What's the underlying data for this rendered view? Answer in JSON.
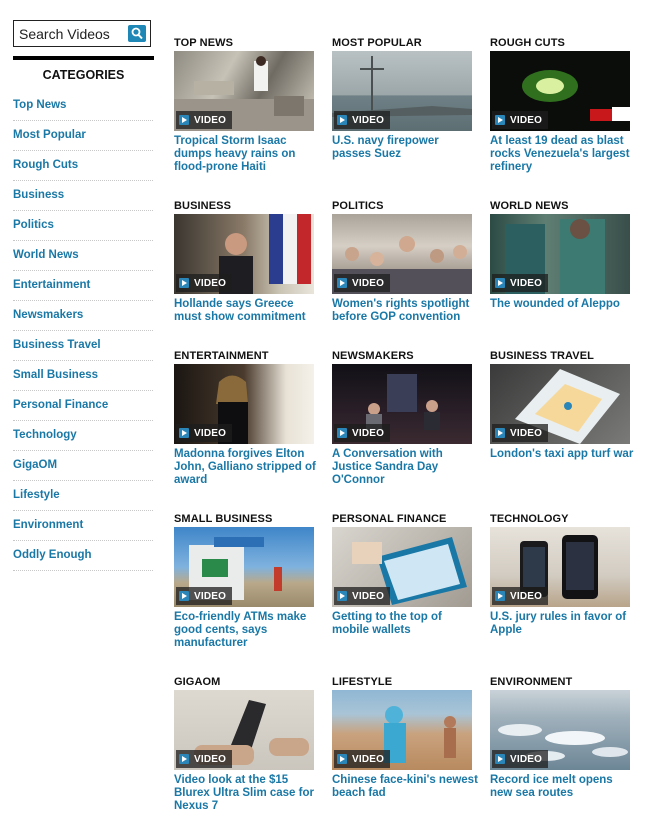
{
  "search": {
    "placeholder": "Search Videos"
  },
  "sidebar": {
    "title": "CATEGORIES",
    "items": [
      {
        "label": "Top News"
      },
      {
        "label": "Most Popular"
      },
      {
        "label": "Rough Cuts"
      },
      {
        "label": "Business"
      },
      {
        "label": "Politics"
      },
      {
        "label": "World News"
      },
      {
        "label": "Entertainment"
      },
      {
        "label": "Newsmakers"
      },
      {
        "label": "Business Travel"
      },
      {
        "label": "Small Business"
      },
      {
        "label": "Personal Finance"
      },
      {
        "label": "Technology"
      },
      {
        "label": "GigaOM"
      },
      {
        "label": "Lifestyle"
      },
      {
        "label": "Environment"
      },
      {
        "label": "Oddly Enough"
      }
    ]
  },
  "video_badge": "VIDEO",
  "cards": [
    {
      "label": "TOP NEWS",
      "headline": "Tropical Storm Isaac dumps heavy rains on flood-prone Haiti"
    },
    {
      "label": "MOST POPULAR",
      "headline": "U.S. navy firepower passes Suez"
    },
    {
      "label": "ROUGH CUTS",
      "headline": "At least 19 dead as blast rocks Venezuela's largest refinery"
    },
    {
      "label": "BUSINESS",
      "headline": "Hollande says Greece must show commitment"
    },
    {
      "label": "POLITICS",
      "headline": "Women's rights spotlight before GOP convention"
    },
    {
      "label": "WORLD NEWS",
      "headline": "The wounded of Aleppo"
    },
    {
      "label": "ENTERTAINMENT",
      "headline": "Madonna forgives Elton John, Galliano stripped of award"
    },
    {
      "label": "NEWSMAKERS",
      "headline": "A Conversation with Justice Sandra Day O'Connor"
    },
    {
      "label": "BUSINESS TRAVEL",
      "headline": "London's taxi app turf war"
    },
    {
      "label": "SMALL BUSINESS",
      "headline": "Eco-friendly ATMs make good cents, says manufacturer"
    },
    {
      "label": "PERSONAL FINANCE",
      "headline": "Getting to the top of mobile wallets"
    },
    {
      "label": "TECHNOLOGY",
      "headline": "U.S. jury rules in favor of Apple"
    },
    {
      "label": "GIGAOM",
      "headline": "Video look at the $15 Blurex Ultra Slim case for Nexus 7"
    },
    {
      "label": "LIFESTYLE",
      "headline": "Chinese face-kini's newest beach fad"
    },
    {
      "label": "ENVIRONMENT",
      "headline": "Record ice melt opens new sea routes"
    }
  ],
  "colors": {
    "link": "#1a78a6",
    "search_button": "#1e87b5",
    "play_icon": "#2a86b9"
  }
}
